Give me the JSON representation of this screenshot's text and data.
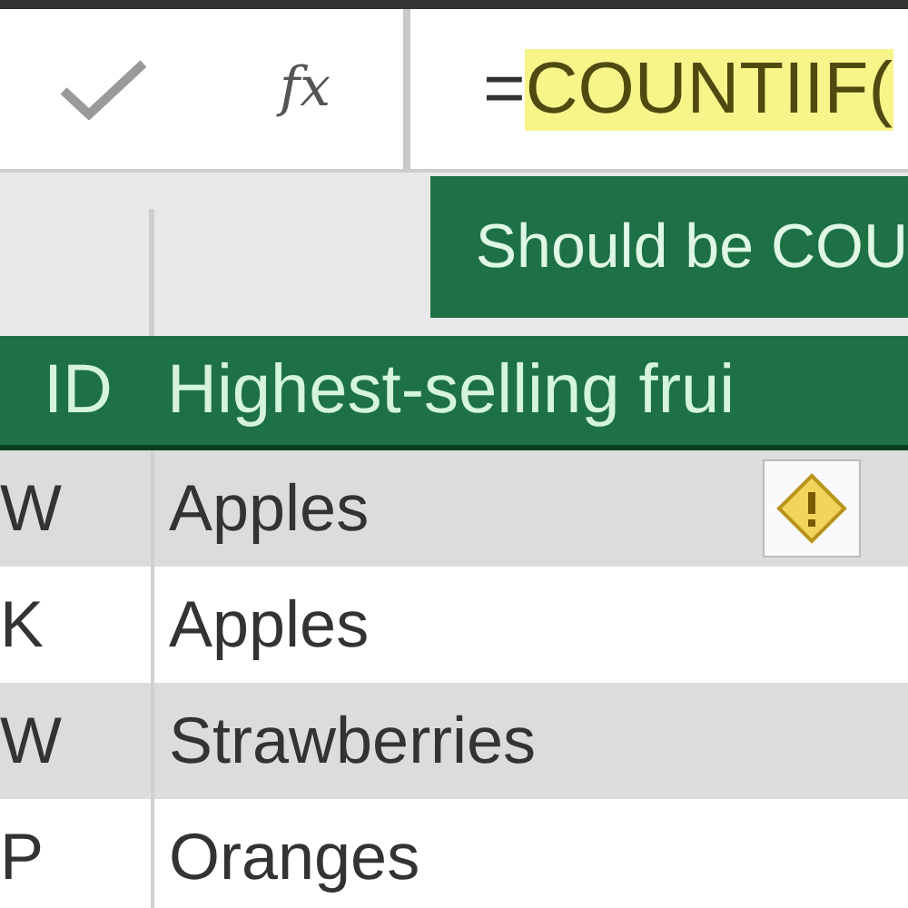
{
  "formula_bar": {
    "function_symbol": "fx",
    "formula_prefix": "=",
    "formula_function": "COUNTIIF(",
    "tooltip": "Should be COU"
  },
  "table": {
    "columns": [
      "ID",
      "Highest-selling frui"
    ],
    "rows": [
      {
        "cells": [
          "W",
          "Apples"
        ],
        "shaded": true,
        "error": true
      },
      {
        "cells": [
          "K",
          "Apples"
        ],
        "shaded": false,
        "error": false
      },
      {
        "cells": [
          "W",
          "Strawberries"
        ],
        "shaded": true,
        "error": false
      },
      {
        "cells": [
          "P",
          "Oranges"
        ],
        "shaded": false,
        "error": false
      }
    ]
  }
}
